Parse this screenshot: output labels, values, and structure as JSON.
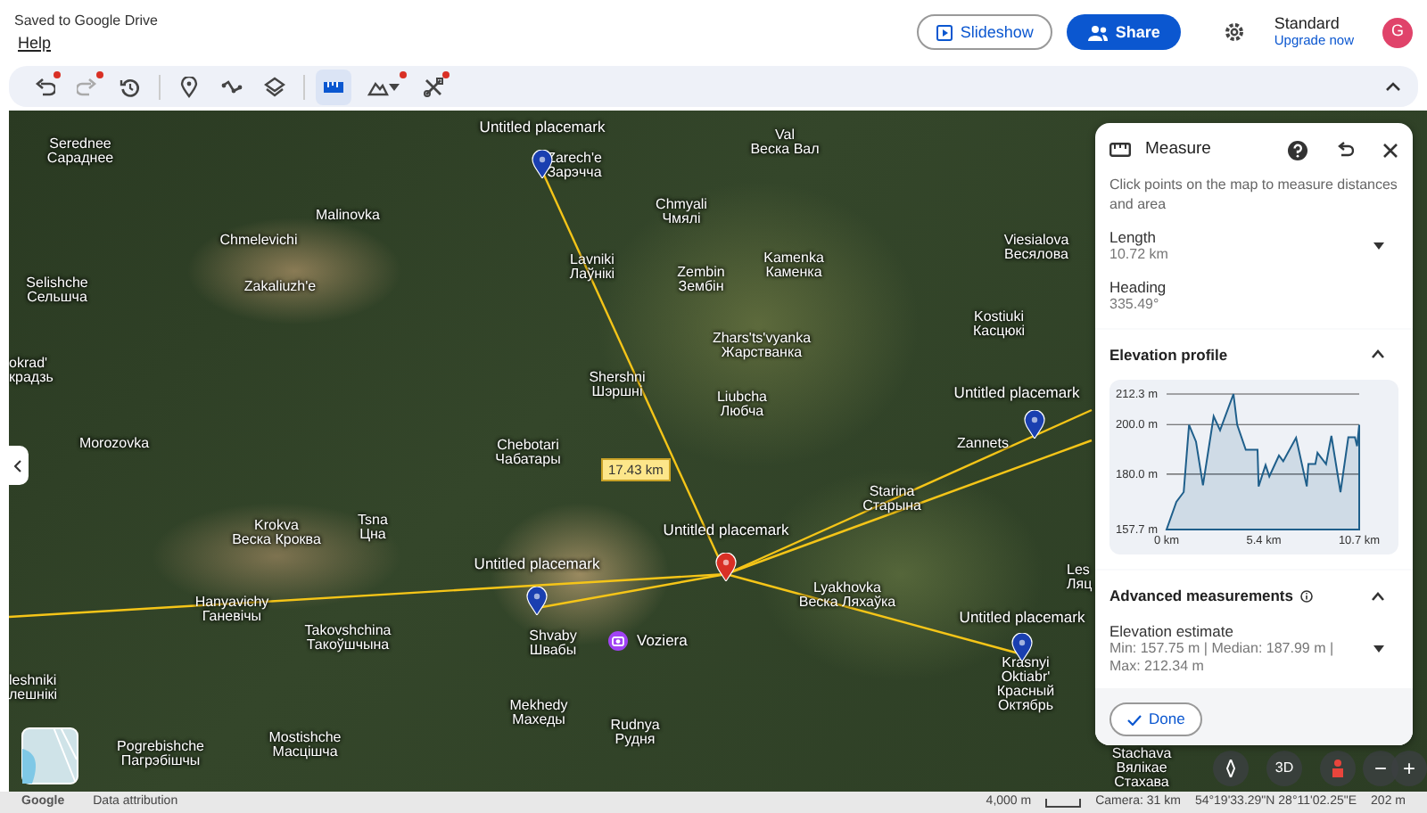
{
  "header": {
    "save_status": "Saved to Google Drive",
    "menu": [
      "Help"
    ],
    "slideshow_button": "Slideshow",
    "share_button": "Share",
    "plan": {
      "name": "Standard",
      "upgrade_link": "Upgrade now"
    },
    "avatar": "G"
  },
  "toolbar": {
    "groups": [
      [
        {
          "kind": "undo",
          "disabled": false,
          "dot": true,
          "selected": false
        },
        {
          "kind": "redo",
          "disabled": true,
          "dot": true,
          "selected": false
        },
        {
          "kind": "history",
          "disabled": false,
          "dot": false,
          "selected": false
        }
      ],
      [
        {
          "kind": "placemark",
          "disabled": false,
          "dot": false,
          "selected": false
        },
        {
          "kind": "path",
          "disabled": false,
          "dot": false,
          "selected": false
        },
        {
          "kind": "layers",
          "disabled": false,
          "dot": false,
          "selected": false
        }
      ],
      [
        {
          "kind": "measure",
          "disabled": false,
          "dot": false,
          "selected": true
        },
        {
          "kind": "terrain",
          "disabled": false,
          "dot": true,
          "selected": false
        },
        {
          "kind": "tools",
          "disabled": false,
          "dot": true,
          "selected": false
        }
      ]
    ]
  },
  "map": {
    "labels": [
      {
        "lines": [
          "Serednee",
          "Сараднее"
        ]
      },
      {
        "lines": [
          "Zarech'e",
          "Зарэчча"
        ]
      },
      {
        "lines": [
          "Val",
          "Веска Вал"
        ]
      },
      {
        "lines": [
          "Malinovka"
        ]
      },
      {
        "lines": [
          "Chmyali",
          "Чмялі"
        ]
      },
      {
        "lines": [
          "Chmelevichi"
        ]
      },
      {
        "lines": [
          "Viesialova",
          "Весялова"
        ]
      },
      {
        "lines": [
          "Selishche",
          "Сельшча"
        ]
      },
      {
        "lines": [
          "Zakaliuzh'e"
        ]
      },
      {
        "lines": [
          "Lavniki",
          "Лаўнікі"
        ]
      },
      {
        "lines": [
          "Zembin",
          "Зембін"
        ]
      },
      {
        "lines": [
          "Kamenka",
          "Каменка"
        ]
      },
      {
        "lines": [
          "okrad'",
          "крадзь"
        ]
      },
      {
        "lines": [
          "Zhars'ts'vyanka",
          "Жарстванка"
        ]
      },
      {
        "lines": [
          "Kostiuki",
          "Касцюкі"
        ]
      },
      {
        "lines": [
          "Shershni",
          "Шэршні"
        ]
      },
      {
        "lines": [
          "Liubcha",
          "Любча"
        ]
      },
      {
        "lines": [
          "Morozovka"
        ]
      },
      {
        "lines": [
          "Chebotari",
          "Чабатары"
        ]
      },
      {
        "lines": [
          "Zannets"
        ]
      },
      {
        "lines": [
          "Krokva",
          "Веска Кроква"
        ]
      },
      {
        "lines": [
          "Tsna",
          "Цна"
        ]
      },
      {
        "lines": [
          "Starina",
          "Старына"
        ]
      },
      {
        "lines": [
          "Hanyavichy",
          "Ганевічы"
        ]
      },
      {
        "lines": [
          "Lyakhovka",
          "Веска Ляхаўка"
        ]
      },
      {
        "lines": [
          "Les",
          "Ляц"
        ]
      },
      {
        "lines": [
          "Takovshchina",
          "Такоўшчына"
        ]
      },
      {
        "lines": [
          "Shvaby",
          "Швабы"
        ]
      },
      {
        "lines": [
          "leshniki",
          "лешнікі"
        ]
      },
      {
        "lines": [
          "Mekhedy",
          "Махеды"
        ]
      },
      {
        "lines": [
          "Krasnyi",
          "Oktiabr'",
          "Красный",
          "Октябрь"
        ]
      },
      {
        "lines": [
          "Pogrebishche",
          "Пагрэбішчы"
        ]
      },
      {
        "lines": [
          "Mostishche",
          "Масцішча"
        ]
      },
      {
        "lines": [
          "Rudnya",
          "Рудня"
        ]
      },
      {
        "lines": [
          "Stachava",
          "Вялікае",
          "Стахава"
        ]
      }
    ],
    "placemarks": [
      {
        "label": "Untitled placemark",
        "selected": false
      },
      {
        "label": "Untitled placemark",
        "selected": false
      },
      {
        "label": "Untitled placemark",
        "selected": true
      },
      {
        "label": "Untitled placemark",
        "selected": false
      },
      {
        "label": "Untitled placemark",
        "selected": false
      }
    ],
    "distance_label": "17.43 km",
    "place": {
      "name": "Voziera"
    },
    "controls": {
      "view_3d": "3D",
      "zoom_out": "−",
      "zoom_in": "+"
    },
    "status_bar": {
      "logo": "Google",
      "attribution": "Data attribution",
      "scale": "4,000 m",
      "camera": "Camera: 31 km",
      "coordinates": "54°19'33.29\"N 28°11'02.25\"E",
      "altitude": "202 m"
    }
  },
  "measure_panel": {
    "title": "Measure",
    "hint": "Click points on the map to measure distances and area",
    "metrics": [
      {
        "label": "Length",
        "value": "10.72 km",
        "kind": "dropdown"
      },
      {
        "label": "Heading",
        "value": "335.49°",
        "kind": "plain"
      }
    ],
    "elevation_profile": {
      "title": "Elevation profile",
      "expanded": true,
      "chart_data": {
        "type": "area",
        "x": [
          0,
          0.54,
          0.95,
          1.25,
          1.63,
          2.02,
          2.62,
          2.97,
          3.72,
          3.92,
          4.4,
          5.05,
          5.11,
          5.5,
          5.71,
          6.24,
          6.48,
          7.19,
          7.79,
          7.88,
          8.26,
          8.38,
          8.86,
          9.15,
          9.66,
          10.1,
          10.46,
          10.58,
          10.7
        ],
        "series": [
          {
            "color": "#1f5f8b",
            "values": [
              157.7,
              168.8,
              172.8,
              199.9,
              193.1,
              175.5,
              203.3,
              197.7,
              212.3,
              199.9,
              189.8,
              189.8,
              175.1,
              183.7,
              179.1,
              187.5,
              185.2,
              194.7,
              175.1,
              184.1,
              184.1,
              188.6,
              184.1,
              195.4,
              172.8,
              194.9,
              194.9,
              191.3,
              199.9
            ]
          }
        ],
        "xlim": [
          0,
          10.7
        ],
        "ylim": [
          157.7,
          212.3
        ],
        "xticks": [
          {
            "value": 0,
            "label": "0 km"
          },
          {
            "value": 5.4,
            "label": "5.4 km"
          },
          {
            "value": 10.7,
            "label": "10.7 km"
          }
        ],
        "yticks": [
          {
            "value": 157.7,
            "label": "157.7 m"
          },
          {
            "value": 180,
            "label": "180.0 m"
          },
          {
            "value": 200,
            "label": "200.0 m"
          },
          {
            "value": 212.3,
            "label": "212.3 m"
          }
        ]
      }
    },
    "advanced": {
      "title": "Advanced measurements",
      "expanded": true,
      "items": [
        {
          "label": "Elevation estimate",
          "value": "Min: 157.75 m | Median: 187.99 m | Max: 212.34 m",
          "kind": "dropdown"
        }
      ]
    },
    "done_button": "Done"
  }
}
